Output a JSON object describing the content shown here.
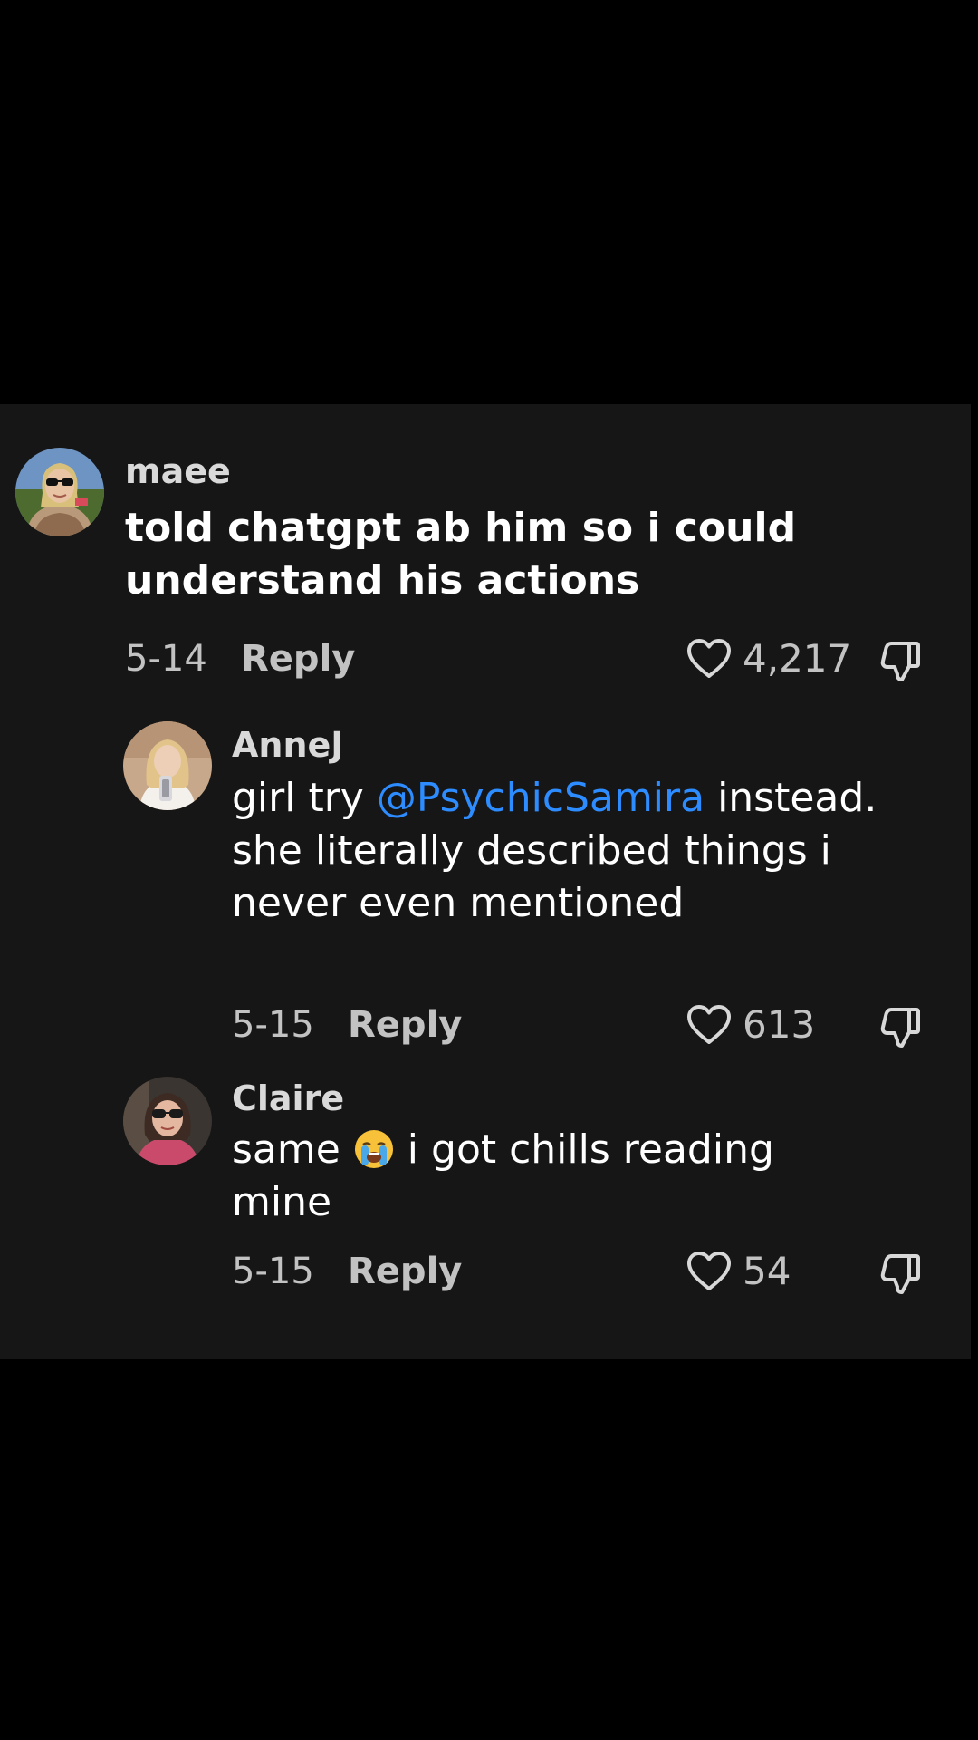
{
  "comments": [
    {
      "username": "maee",
      "text": "told chatgpt ab him so i could understand his actions",
      "date": "5-14",
      "reply_label": "Reply",
      "likes": "4,217"
    },
    {
      "username": "AnneJ",
      "text_before": "girl try ",
      "mention": "@PsychicSamira",
      "text_after": " instead. she literally described things i never even mentioned",
      "date": "5-15",
      "reply_label": "Reply",
      "likes": "613"
    },
    {
      "username": "Claire",
      "text_before": "same ",
      "emoji": "loudly-crying-face",
      "text_after": " i got chills reading mine",
      "date": "5-15",
      "reply_label": "Reply",
      "likes": "54"
    }
  ],
  "icons": {
    "like": "heart-outline-icon",
    "dislike": "thumbs-down-icon"
  },
  "colors": {
    "background": "#000000",
    "panel": "#161616",
    "mention": "#2d8cff",
    "secondary_text": "#c2c2c2"
  }
}
